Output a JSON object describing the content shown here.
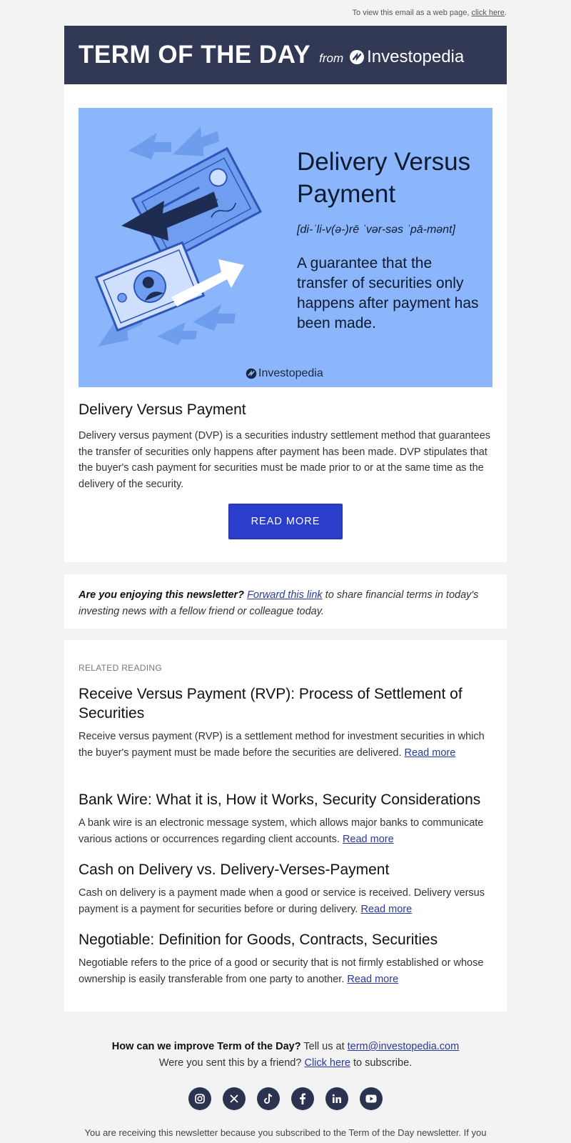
{
  "top_bar": {
    "prefix": "To view this email as a web page, ",
    "link": "click here",
    "suffix": "."
  },
  "header": {
    "title": "TERM OF THE DAY",
    "from": "from",
    "brand": "Investopedia",
    "bg_color": "#313955"
  },
  "hero": {
    "title": "Delivery Versus Payment",
    "pronunciation": "[di-ˈli-v(ə-)rē ˈvər-səs ˈpā-mənt]",
    "definition": "A guarantee that the transfer of securities only happens after payment has been made.",
    "brand": "Investopedia",
    "bg_color": "#8bb6fb"
  },
  "term": {
    "title": "Delivery Versus Payment",
    "body": "Delivery versus payment (DVP) is a securities industry settlement method that guarantees the transfer of securities only happens after payment has been made. DVP stipulates that the buyer's cash payment for securities must be made prior to or at the same time as the delivery of the security.",
    "button": "READ MORE",
    "button_color": "#2b3ecb"
  },
  "share": {
    "question": "Are you enjoying this newsletter?",
    "link": "Forward this link",
    "rest": " to share financial terms in today's investing news with a fellow friend or colleague today."
  },
  "related": {
    "label": "RELATED READING",
    "read_more": "Read more",
    "articles": [
      {
        "title": "Receive Versus Payment (RVP): Process of Settlement of Securities",
        "summary": "Receive versus payment (RVP) is a settlement method for investment securities in which the buyer's payment must be made before the securities are delivered. "
      },
      {
        "title": "Bank Wire: What it is, How it Works, Security Considerations",
        "summary": "A bank wire is an electronic message system, which allows major banks to communicate various actions or occurrences regarding client accounts. "
      },
      {
        "title": "Cash on Delivery vs. Delivery-Verses-Payment",
        "summary": "Cash on delivery is a payment made when a good or service is received. Delivery versus payment is a payment for securities before or during delivery. "
      },
      {
        "title": "Negotiable: Definition for Goods, Contracts, Securities",
        "summary": "Negotiable refers to the price of a good or security that is not firmly established or whose ownership is easily transferable from one party to another. "
      }
    ]
  },
  "footer": {
    "improve_question": "How can we improve Term of the Day?",
    "tell_us": " Tell us at ",
    "email": "term@investopedia.com",
    "friend_prefix": "Were you sent this by a friend? ",
    "friend_link": "Click here",
    "friend_suffix": " to subscribe.",
    "socials": [
      "instagram-icon",
      "x-icon",
      "tiktok-icon",
      "facebook-icon",
      "linkedin-icon",
      "youtube-icon"
    ],
    "fine_print": "You are receiving this newsletter because you subscribed to the Term of the Day newsletter. If you"
  }
}
